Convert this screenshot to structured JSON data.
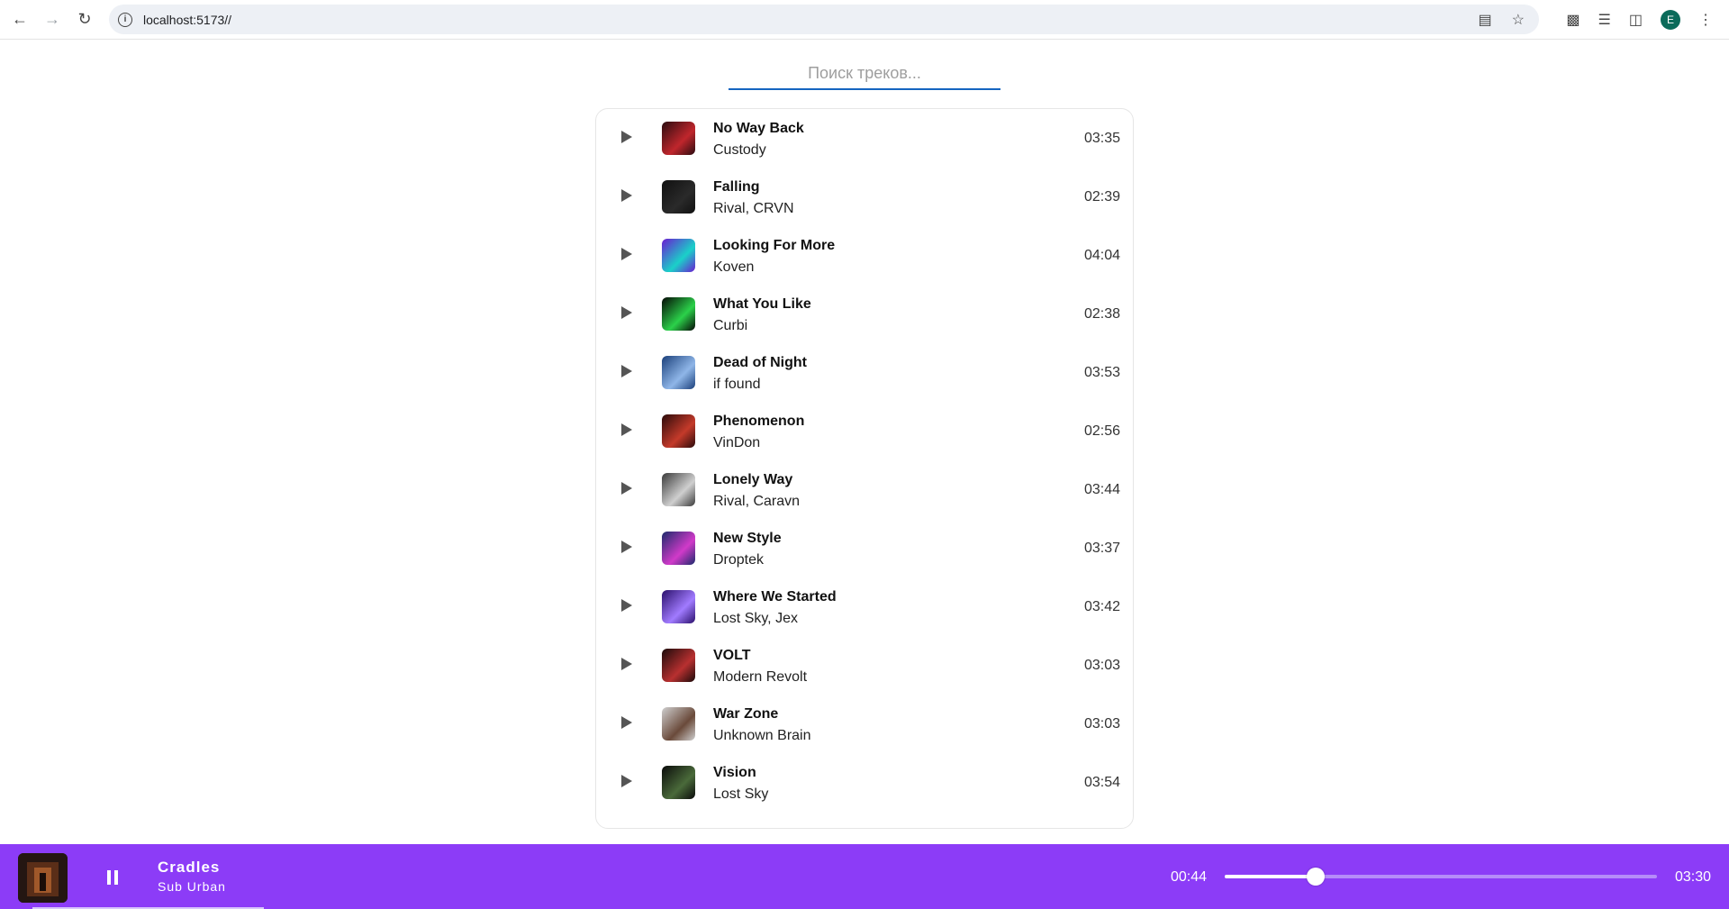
{
  "browser": {
    "url": "localhost:5173//",
    "avatar_letter": "E"
  },
  "search": {
    "placeholder": "Поиск треков..."
  },
  "tracks": [
    {
      "title": "No Way Back",
      "artist": "Custody",
      "duration": "03:35",
      "cover_colors": [
        "#2a0c10",
        "#c0262c"
      ]
    },
    {
      "title": "Falling",
      "artist": "Rival, CRVN",
      "duration": "02:39",
      "cover_colors": [
        "#101010",
        "#2a2a2a"
      ]
    },
    {
      "title": "Looking For More",
      "artist": "Koven",
      "duration": "04:04",
      "cover_colors": [
        "#6a1bd1",
        "#1ad1c9"
      ]
    },
    {
      "title": "What You Like",
      "artist": "Curbi",
      "duration": "02:38",
      "cover_colors": [
        "#050805",
        "#2bd14a"
      ]
    },
    {
      "title": "Dead of Night",
      "artist": "if found",
      "duration": "03:53",
      "cover_colors": [
        "#1a3f7a",
        "#8fb6e8"
      ]
    },
    {
      "title": "Phenomenon",
      "artist": "VinDon",
      "duration": "02:56",
      "cover_colors": [
        "#2a0a0a",
        "#c43a2a"
      ]
    },
    {
      "title": "Lonely Way",
      "artist": "Rival, Caravn",
      "duration": "03:44",
      "cover_colors": [
        "#3a3a3a",
        "#cfcfcf"
      ]
    },
    {
      "title": "New Style",
      "artist": "Droptek",
      "duration": "03:37",
      "cover_colors": [
        "#1b2a6b",
        "#d13ac9"
      ]
    },
    {
      "title": "Where We Started",
      "artist": "Lost Sky, Jex",
      "duration": "03:42",
      "cover_colors": [
        "#2a0f6b",
        "#a17bff"
      ]
    },
    {
      "title": "VOLT",
      "artist": "Modern Revolt",
      "duration": "03:03",
      "cover_colors": [
        "#1a0a0a",
        "#b83030"
      ]
    },
    {
      "title": "War Zone",
      "artist": "Unknown Brain",
      "duration": "03:03",
      "cover_colors": [
        "#cfcfcf",
        "#6a4a3a"
      ]
    },
    {
      "title": "Vision",
      "artist": "Lost Sky",
      "duration": "03:54",
      "cover_colors": [
        "#0a0a0a",
        "#4a6a3a"
      ]
    }
  ],
  "player": {
    "title": "Cradles",
    "artist": "Sub Urban",
    "current_time": "00:44",
    "total_time": "03:30",
    "progress_fraction": 0.2095,
    "accent_color": "#8c3cf7"
  }
}
